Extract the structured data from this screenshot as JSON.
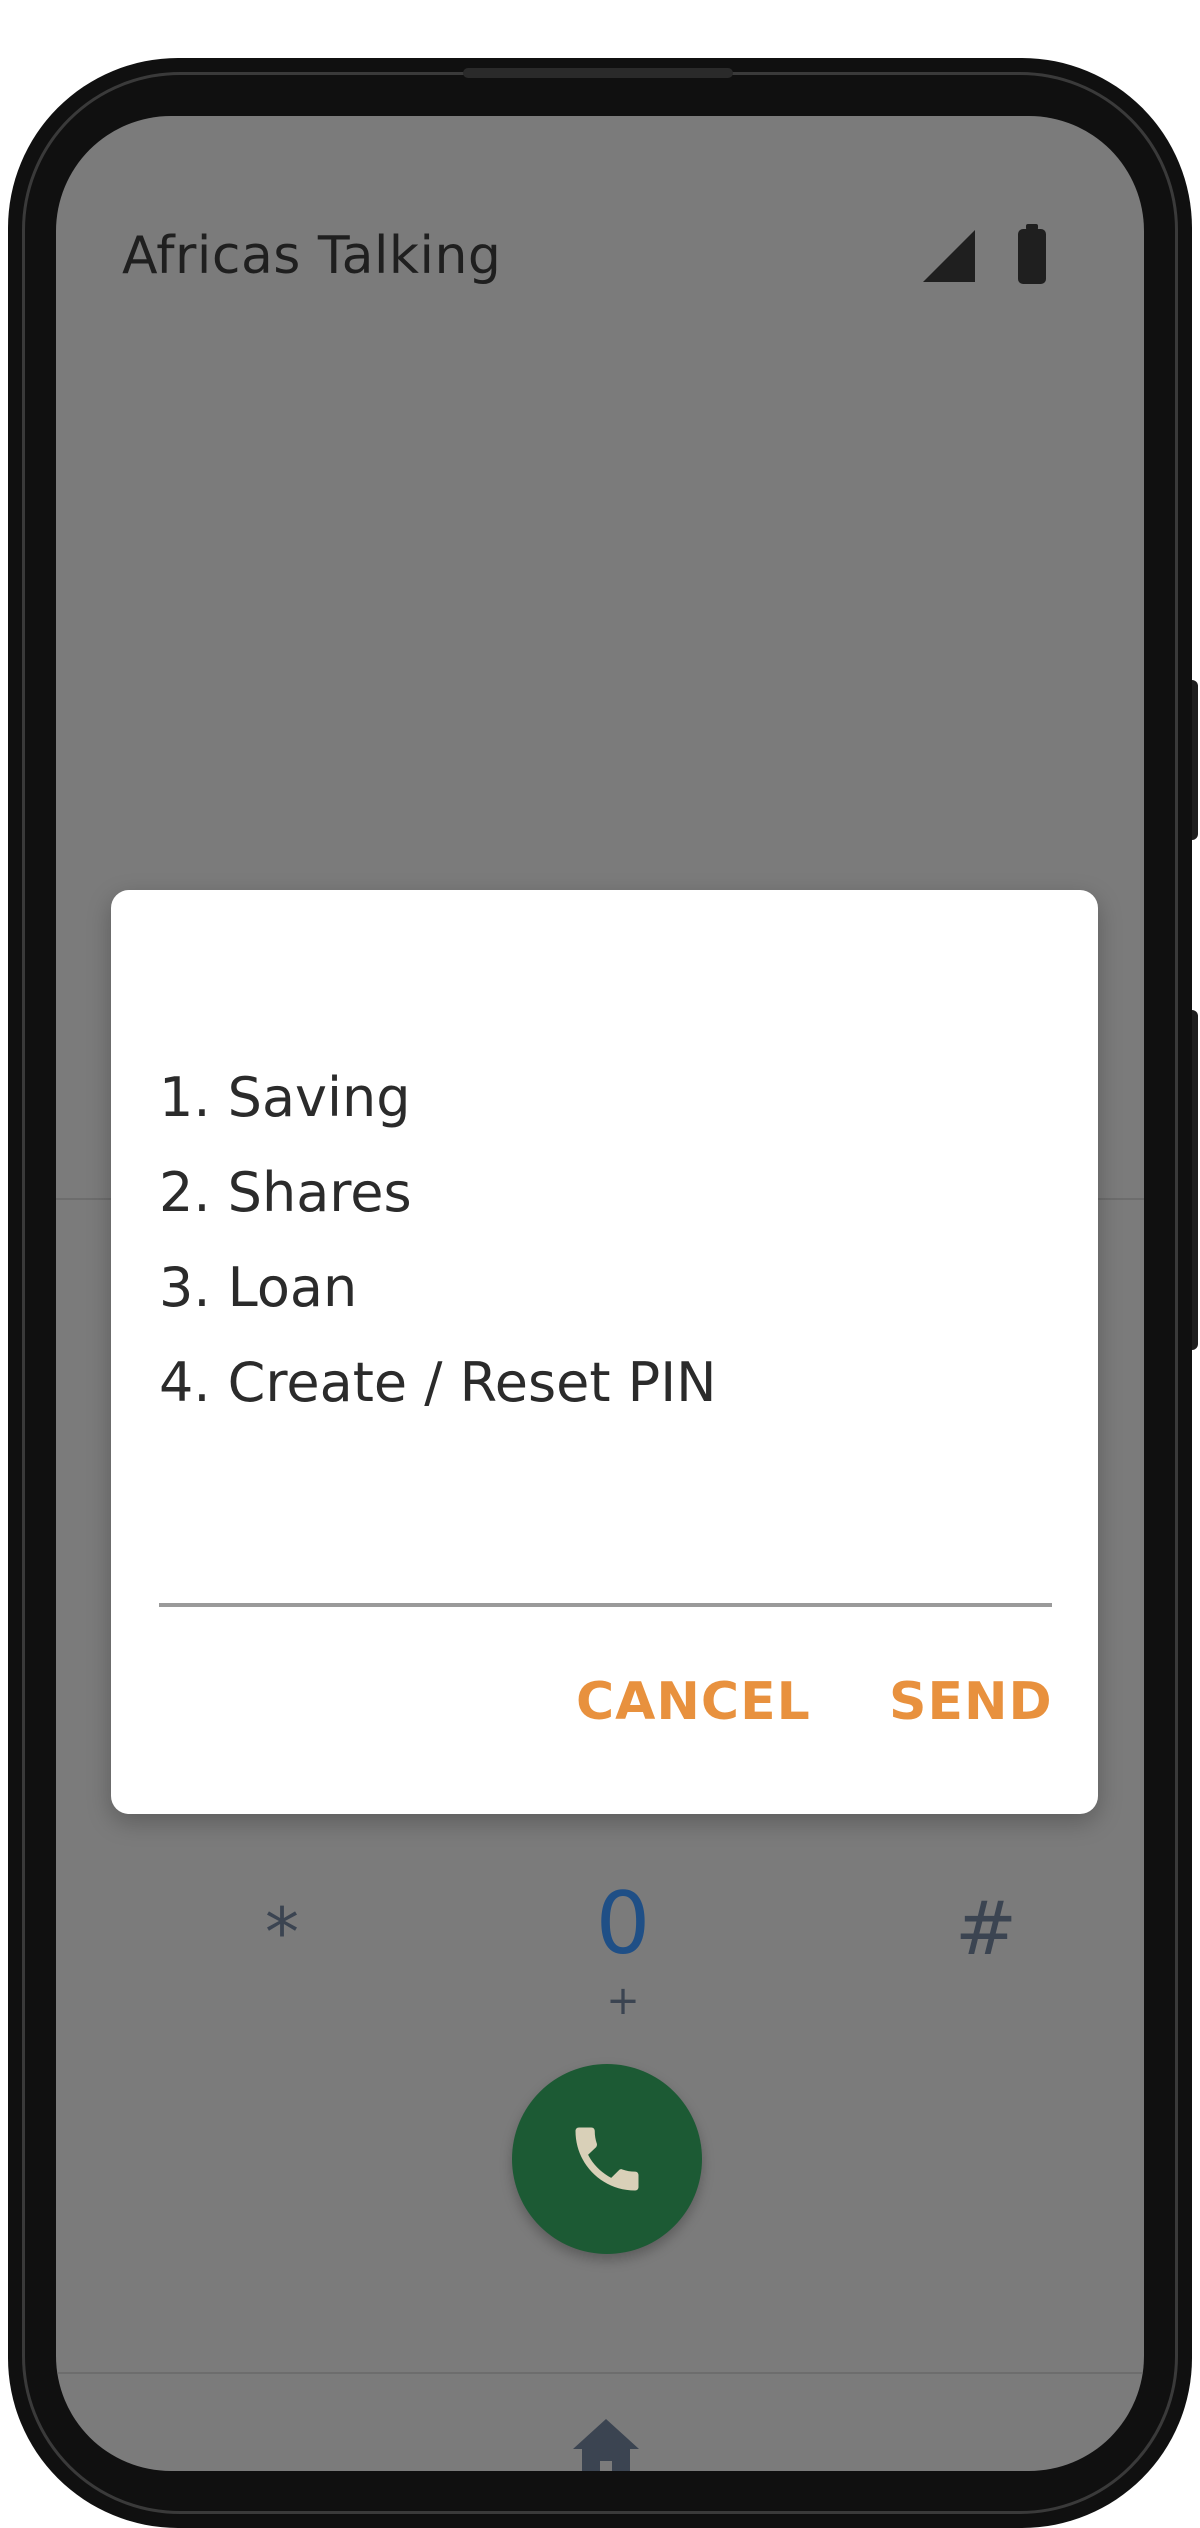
{
  "status_bar": {
    "title": "Africas Talking",
    "signal_icon": "cellular-signal-icon",
    "battery_icon": "battery-icon"
  },
  "dialpad": {
    "star": "*",
    "zero": "0",
    "zero_sub": "+",
    "hash": "#",
    "call_icon": "phone-icon",
    "call_color": "#1c5a34"
  },
  "nav": {
    "home_icon": "home-icon"
  },
  "ussd_dialog": {
    "menu_items": [
      "1. Saving",
      "2. Shares",
      "3. Loan",
      "4. Create / Reset PIN"
    ],
    "input_value": "",
    "cancel_label": "CANCEL",
    "send_label": "SEND",
    "accent_color": "#e8913e"
  },
  "colors": {
    "scrim": "#7b7b7b",
    "dialog_bg": "#ffffff",
    "phone_frame": "#101010"
  }
}
